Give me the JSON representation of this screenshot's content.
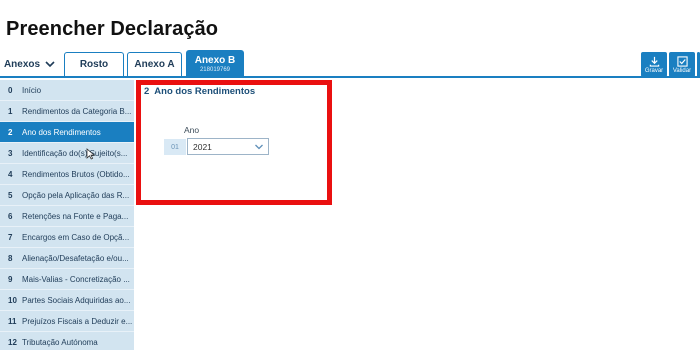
{
  "page": {
    "title": "Preencher Declaração"
  },
  "tabs": {
    "anexos_label": "Anexos",
    "items": [
      {
        "label": "Rosto"
      },
      {
        "label": "Anexo A"
      },
      {
        "label": "Anexo B",
        "sub": "218019769"
      }
    ]
  },
  "toolbar": {
    "gravar_label": "Gravar",
    "validar_label": "Validar"
  },
  "sidebar": {
    "items": [
      {
        "num": "0",
        "label": "Início"
      },
      {
        "num": "1",
        "label": "Rendimentos da Categoria B..."
      },
      {
        "num": "2",
        "label": "Ano dos Rendimentos"
      },
      {
        "num": "3",
        "label": "Identificação do(s) Sujeito(s..."
      },
      {
        "num": "4",
        "label": "Rendimentos Brutos (Obtido..."
      },
      {
        "num": "5",
        "label": "Opção pela Aplicação das R..."
      },
      {
        "num": "6",
        "label": "Retenções na Fonte e Paga..."
      },
      {
        "num": "7",
        "label": "Encargos em Caso de Opçã..."
      },
      {
        "num": "8",
        "label": "Alienação/Desafetação e/ou..."
      },
      {
        "num": "9",
        "label": "Mais-Valias - Concretização ..."
      },
      {
        "num": "10",
        "label": "Partes Sociais Adquiridas ao..."
      },
      {
        "num": "11",
        "label": "Prejuízos Fiscais a Deduzir e..."
      },
      {
        "num": "12",
        "label": "Tributação Autónoma"
      }
    ],
    "active_index": 2
  },
  "section": {
    "number": "2",
    "title": "Ano dos Rendimentos",
    "field_label": "Ano",
    "row_number": "01",
    "select_value": "2021"
  },
  "colors": {
    "accent": "#1a7fc1",
    "sidebar_bg": "#d2e4f0",
    "highlight": "#ea1010"
  },
  "icons": {
    "anexos": "chevron-down-icon",
    "gravar": "download-icon",
    "validar": "check-icon",
    "select": "chevron-down-icon",
    "cursor": "mouse-pointer-icon"
  }
}
